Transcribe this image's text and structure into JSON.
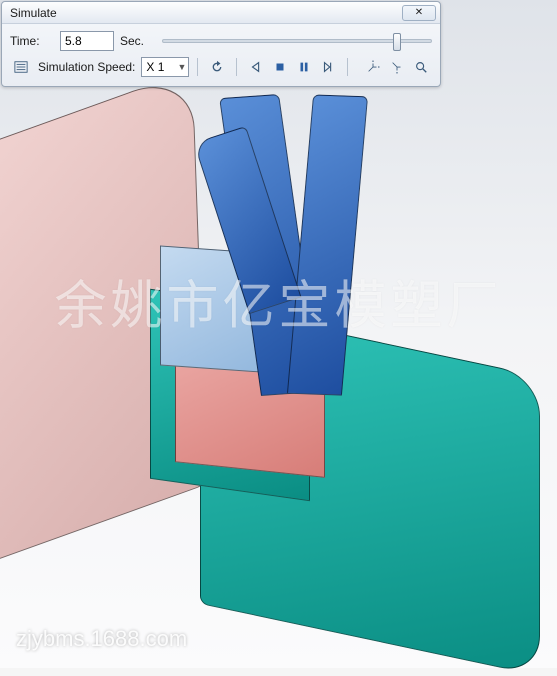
{
  "panel": {
    "title": "Simulate",
    "time_label": "Time:",
    "time_value": "5.8",
    "time_unit": "Sec.",
    "speed_label": "Simulation Speed:",
    "speed_value": "X 1"
  },
  "watermark": {
    "chinese": "余姚市亿宝模塑厂",
    "url": "zjybms.1688.com"
  },
  "icons": {
    "close": "✕",
    "list": "list-icon",
    "restart": "↻",
    "prev": "◁",
    "stop": "■",
    "pause": "❚❚",
    "next": "▷|",
    "tool1": "⤴",
    "tool2": "⤵",
    "zoom": "⊕"
  }
}
